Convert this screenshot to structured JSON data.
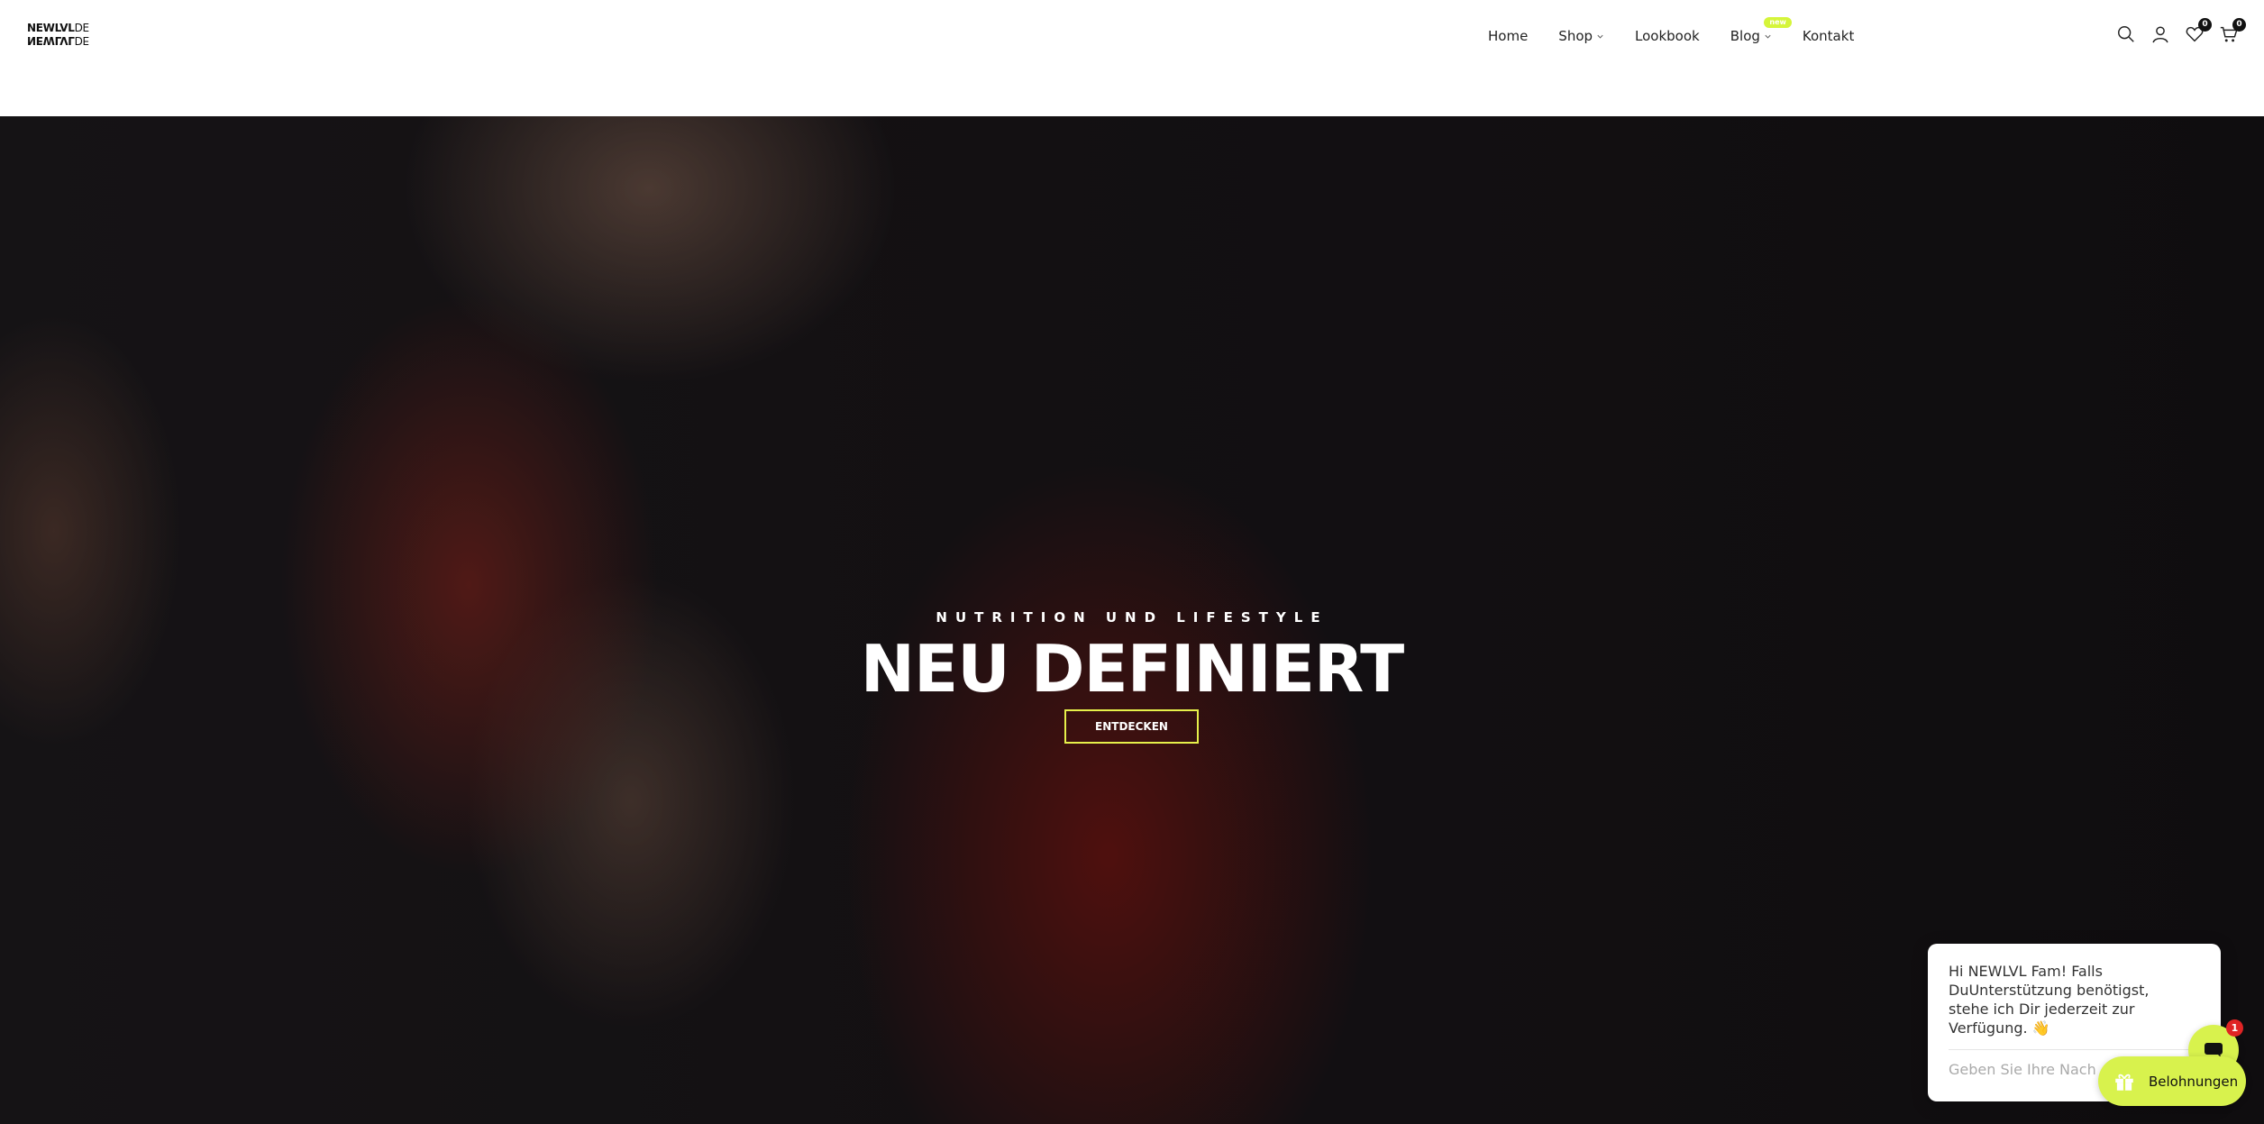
{
  "header": {
    "logo": {
      "line1_bold": "NEWLVL",
      "line1_thin": "DE"
    },
    "nav": {
      "home": "Home",
      "shop": "Shop",
      "lookbook": "Lookbook",
      "blog": "Blog",
      "blog_badge": "new",
      "kontakt": "Kontakt"
    },
    "icons": {
      "search": "search-icon",
      "account": "user-icon",
      "wishlist": "heart-icon",
      "cart": "cart-icon"
    },
    "wishlist_count": "0",
    "cart_count": "0"
  },
  "hero": {
    "subtitle": "NUTRITION UND LIFESTYLE",
    "title": "NEU DEFINIERT",
    "cta_label": "ENTDECKEN",
    "accent_color": "#e6f04a"
  },
  "chat": {
    "message": "Hi NEWLVL Fam! Falls DuUnterstützung benötigst, stehe ich Dir jederzeit zur Verfügung. 👋",
    "input_placeholder": "Geben Sie Ihre Nachricht ein",
    "unread_count": "1"
  },
  "rewards": {
    "label": "Belohnungen",
    "color": "#d8f24d"
  }
}
